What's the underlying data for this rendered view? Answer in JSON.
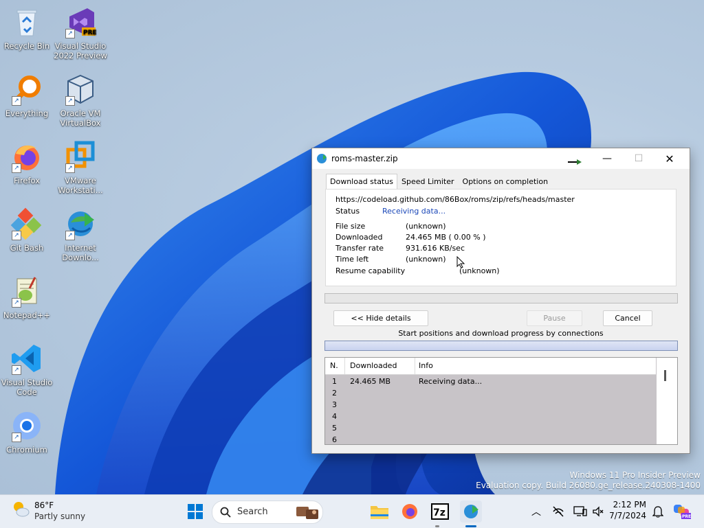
{
  "desktop": {
    "icons": [
      {
        "label": "Recycle Bin"
      },
      {
        "label": "Visual Studio 2022 Preview"
      },
      {
        "label": "Everything"
      },
      {
        "label": "Oracle VM VirtualBox"
      },
      {
        "label": "Firefox"
      },
      {
        "label": "VMware Workstati..."
      },
      {
        "label": "Git Bash"
      },
      {
        "label": "Internet Downlo..."
      },
      {
        "label": "Notepad++"
      },
      {
        "label": "Visual Studio Code"
      },
      {
        "label": "Chromium"
      }
    ],
    "watermark": {
      "line1": "Windows 11 Pro Insider Preview",
      "line2": "Evaluation copy. Build 26080.ge_release.240308-1400"
    }
  },
  "window": {
    "title": "roms-master.zip",
    "tabs": [
      "Download status",
      "Speed Limiter",
      "Options on completion"
    ],
    "url": "https://codeload.github.com/86Box/roms/zip/refs/heads/master",
    "status_label": "Status",
    "status_value": "Receiving data...",
    "fields": [
      {
        "label": "File size",
        "value": "(unknown)"
      },
      {
        "label": "Downloaded",
        "value": "24.465  MB  ( 0.00 % )"
      },
      {
        "label": "Transfer rate",
        "value": "931.616  KB/sec"
      },
      {
        "label": "Time left",
        "value": "(unknown)"
      },
      {
        "label": "Resume capability",
        "value": "(unknown)"
      }
    ],
    "buttons": {
      "hide_details": "<< Hide details",
      "pause": "Pause",
      "cancel": "Cancel"
    },
    "connections_caption": "Start positions and download progress by connections",
    "table": {
      "headers": [
        "N.",
        "Downloaded",
        "Info"
      ],
      "rows": [
        {
          "n": "1",
          "downloaded": "24.465  MB",
          "info": "Receiving data..."
        },
        {
          "n": "2",
          "downloaded": "",
          "info": ""
        },
        {
          "n": "3",
          "downloaded": "",
          "info": ""
        },
        {
          "n": "4",
          "downloaded": "",
          "info": ""
        },
        {
          "n": "5",
          "downloaded": "",
          "info": ""
        },
        {
          "n": "6",
          "downloaded": "",
          "info": ""
        }
      ]
    }
  },
  "taskbar": {
    "weather_temp": "86°F",
    "weather_cond": "Partly sunny",
    "search_label": "Search",
    "time": "2:12 PM",
    "date": "7/7/2024",
    "icons": [
      "windows-start-icon",
      "search-icon",
      "file-explorer-icon",
      "firefox-icon",
      "7zip-icon",
      "idm-icon",
      "chevron-up-icon",
      "network-icon",
      "display-icon",
      "volume-icon",
      "bell-icon",
      "copilot-icon"
    ]
  },
  "colors": {
    "accent": "#0067c0",
    "link": "#1a47b8"
  }
}
